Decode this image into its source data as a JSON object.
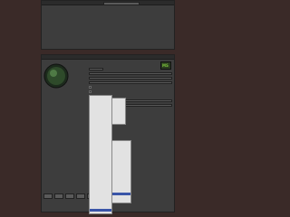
{
  "top_window": {
    "title": "",
    "items": [
      "",
      "",
      "",
      "",
      "",
      "",
      "",
      "",
      ""
    ],
    "field_value": ""
  },
  "main_window": {
    "title": "",
    "badge": "MS",
    "left_labels": [
      "",
      "",
      "",
      "",
      "",
      "",
      "",
      "",
      ""
    ],
    "props": [
      {
        "label": "",
        "value": ""
      },
      {
        "label": "",
        "value": ""
      },
      {
        "label": "",
        "value": ""
      },
      {
        "label": "",
        "value": ""
      },
      {
        "label": "",
        "value": ""
      },
      {
        "label": "",
        "value": ""
      },
      {
        "label": "",
        "value": ""
      }
    ],
    "bottom_buttons": [
      "",
      "",
      "",
      "",
      "",
      "",
      ""
    ]
  },
  "dropdown_menu_1": [
    "",
    "",
    "",
    "",
    "",
    "",
    "",
    "",
    "",
    "",
    "",
    "",
    "",
    "",
    "",
    "",
    "",
    "",
    "",
    "",
    "",
    "",
    "",
    "",
    "",
    "",
    ""
  ],
  "dropdown_menu_2": [
    "",
    "",
    "",
    "",
    "",
    "",
    "",
    "",
    "",
    "",
    "",
    "",
    "",
    "",
    ""
  ],
  "dropdown_menu_3": [
    "",
    "",
    "",
    "",
    "",
    "",
    "",
    "",
    "",
    ""
  ],
  "colors": {
    "background": "#3a2a28",
    "window": "#3d3d3d",
    "menu": "#e2e2e2",
    "highlight": "#3a55a8",
    "badge": "#7ac13a"
  }
}
